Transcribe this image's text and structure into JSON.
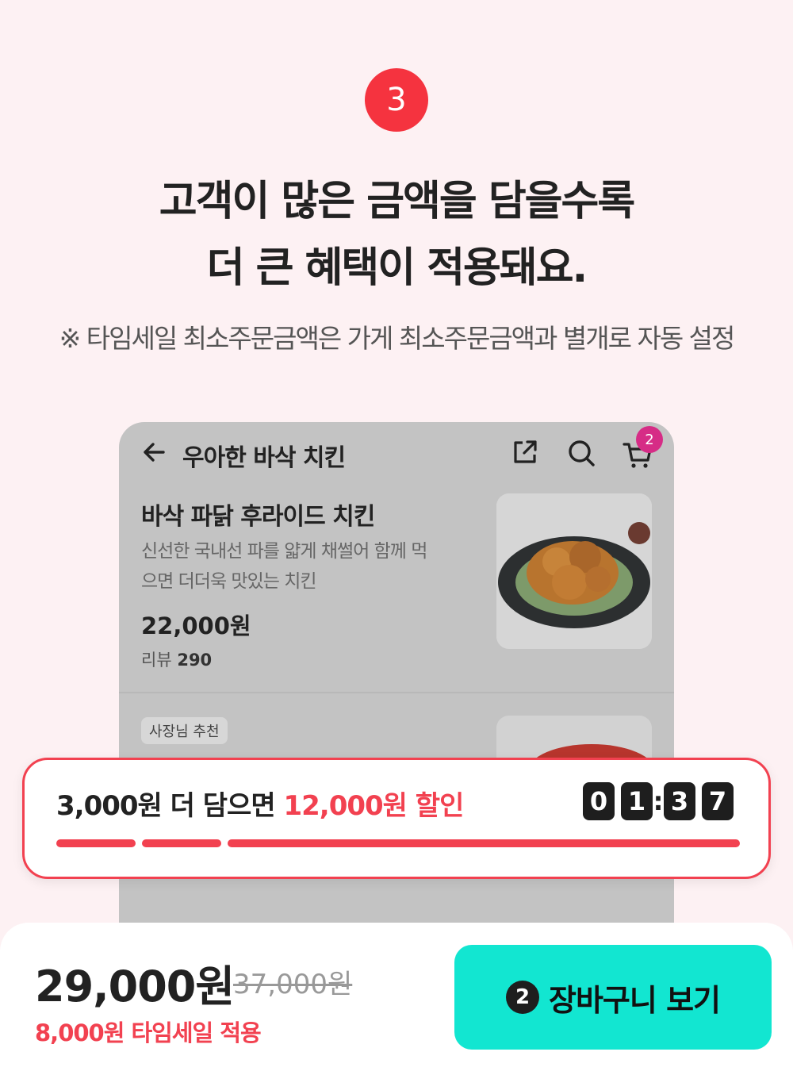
{
  "step_number": "3",
  "headline": {
    "line1": "고객이 많은 금액을 담을수록",
    "line2": "더 큰 혜택이 적용돼요."
  },
  "note": "※ 타임세일 최소주문금액은 가게 최소주문금액과 별개로 자동 설정",
  "app": {
    "store_title": "우아한 바삭 치킨",
    "cart_count": "2",
    "icons": [
      "back-arrow-icon",
      "share-icon",
      "search-icon",
      "cart-icon"
    ],
    "menu_item": {
      "name": "바삭 파닭 후라이드 치킨",
      "description": "신선한 국내선 파를 얇게 채썰어 함께 먹으면 더더욱 맛있는 치킨",
      "price": "22,000원",
      "review_label": "리뷰",
      "review_count": "290"
    },
    "second_item": {
      "tag": "사장님 추천"
    }
  },
  "time_sale": {
    "message_prefix": "3,000원 더 담으면 ",
    "message_highlight": "12,000원 할인",
    "timer": [
      "0",
      "1",
      "3",
      "7"
    ],
    "progress_segments": 3,
    "accent_color": "#f24150"
  },
  "bottom_bar": {
    "total_price": "29,000원",
    "original_price": "37,000원",
    "discount_note": "8,000원 타임세일 적용",
    "cart_badge": "2",
    "cart_button_label": "장바구니 보기",
    "button_color": "#12e6d1"
  }
}
